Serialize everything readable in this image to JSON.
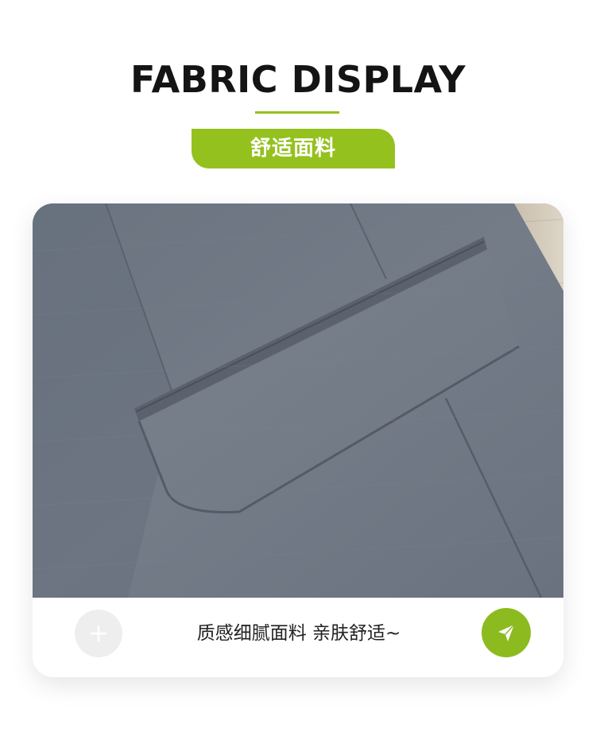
{
  "header": {
    "title": "FABRIC DISPLAY",
    "badge_label": "舒适面料"
  },
  "card": {
    "photo_description_icon": "fabric-photo",
    "caption": "质感细腻面料 亲肤舒适~",
    "add_icon": "plus-icon",
    "send_icon": "send-icon"
  },
  "colors": {
    "accent": "#95c11f",
    "title": "#141414",
    "fabric": "#6f7784"
  }
}
